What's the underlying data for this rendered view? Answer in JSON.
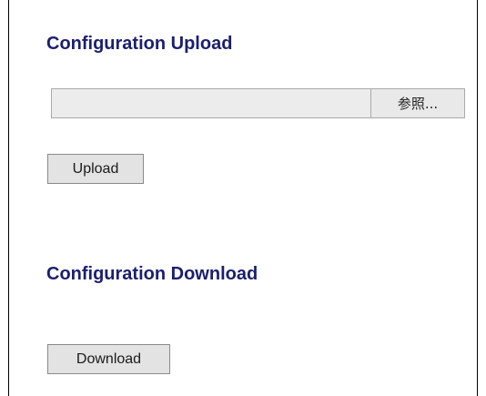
{
  "upload": {
    "title": "Configuration Upload",
    "file_path": "",
    "browse_label": "参照...",
    "upload_label": "Upload"
  },
  "download": {
    "title": "Configuration Download",
    "download_label": "Download"
  }
}
